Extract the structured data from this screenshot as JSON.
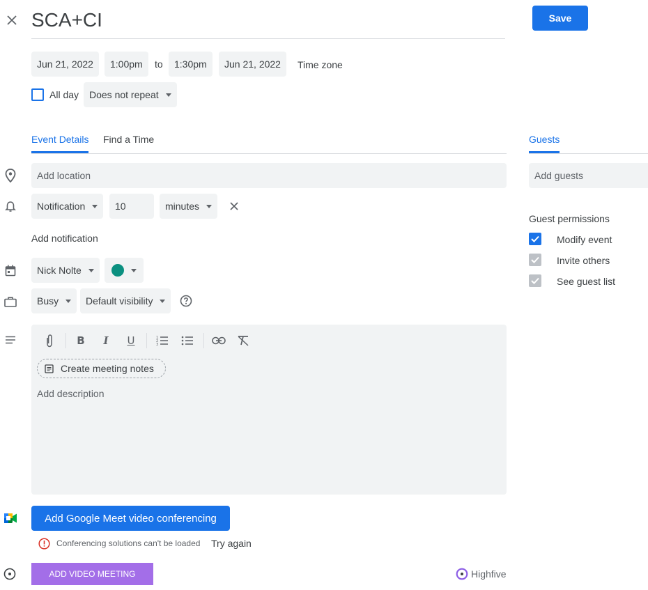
{
  "header": {
    "close_icon": "close-icon",
    "title": "SCA+CI",
    "save_label": "Save"
  },
  "datetime": {
    "start_date": "Jun 21, 2022",
    "start_time": "1:00pm",
    "to_label": "to",
    "end_time": "1:30pm",
    "end_date": "Jun 21, 2022",
    "timezone_label": "Time zone",
    "allday_label": "All day",
    "allday_checked": false,
    "repeat_value": "Does not repeat"
  },
  "tabs": [
    {
      "label": "Event Details",
      "active": true
    },
    {
      "label": "Find a Time",
      "active": false
    }
  ],
  "details": {
    "location_placeholder": "Add location",
    "notification_type": "Notification",
    "notification_value": "10",
    "notification_unit": "minutes",
    "add_notification_label": "Add notification",
    "calendar_owner": "Nick Nolte",
    "calendar_color": "#0b9080",
    "availability": "Busy",
    "visibility": "Default visibility"
  },
  "description": {
    "toolbar_icons": [
      "attachment-icon",
      "bold-icon",
      "italic-icon",
      "underline-icon",
      "numbered-list-icon",
      "bulleted-list-icon",
      "link-icon",
      "clear-formatting-icon"
    ],
    "meeting_notes_label": "Create meeting notes",
    "placeholder": "Add description"
  },
  "conferencing": {
    "meet_button_label": "Add Google Meet video conferencing",
    "error_text": "Conferencing solutions can't be loaded",
    "retry_label": "Try again",
    "video_meeting_label": "ADD VIDEO MEETING",
    "highfive_label": "Highfive"
  },
  "guests": {
    "heading": "Guests",
    "add_placeholder": "Add guests",
    "permissions_heading": "Guest permissions",
    "permissions": [
      {
        "label": "Modify event",
        "checked": true,
        "enabled": true
      },
      {
        "label": "Invite others",
        "checked": true,
        "enabled": false
      },
      {
        "label": "See guest list",
        "checked": true,
        "enabled": false
      }
    ]
  },
  "colors": {
    "primary": "#1a73e8",
    "video_meeting": "#a36ee8",
    "error": "#d93025"
  }
}
